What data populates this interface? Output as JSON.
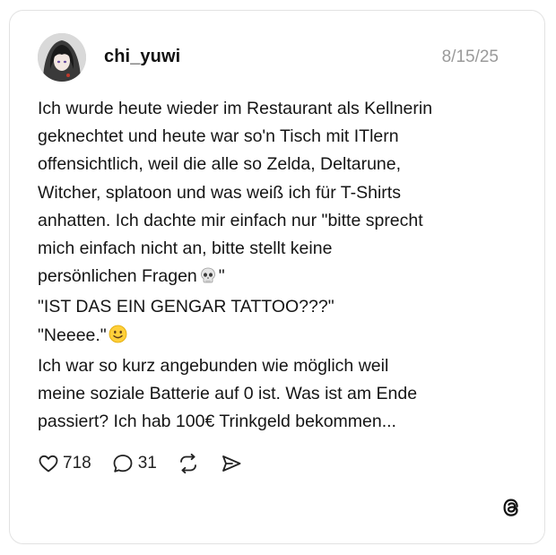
{
  "post": {
    "username": "chi_yuwi",
    "date": "8/15/25",
    "body_lines": [
      {
        "text": "Ich wurde heute wieder im Restaurant als Kellnerin"
      },
      {
        "text": "geknechtet und heute war so'n Tisch mit ITlern"
      },
      {
        "text": "offensichtlich, weil die alle so Zelda, Deltarune,"
      },
      {
        "text": "Witcher,  splatoon und was weiß ich für T-Shirts"
      },
      {
        "text": "anhatten. Ich dachte mir einfach nur \"bitte sprecht"
      },
      {
        "text": "mich einfach nicht an, bitte stellt keine"
      },
      {
        "text": "persönlichen Fragen",
        "emoji": "skull-emoji",
        "after": "\""
      },
      {
        "text": "\"IST DAS EIN GENGAR TATTOO???\""
      },
      {
        "text": "\"Neeee.\"",
        "emoji": "slightly-smiling-face-emoji",
        "after": ""
      },
      {
        "text": "Ich war so kurz angebunden wie möglich weil"
      },
      {
        "text": "meine soziale Batterie auf 0 ist. Was ist am Ende"
      },
      {
        "text": "passiert? Ich hab 100€ Trinkgeld bekommen..."
      }
    ]
  },
  "actions": {
    "likes": "718",
    "replies": "31",
    "icons": [
      "heart-icon",
      "reply-icon",
      "repost-icon",
      "share-icon"
    ]
  },
  "brand": {
    "logo": "threads-logo-icon"
  },
  "colors": {
    "text": "#151515",
    "muted": "#9a9a9a",
    "border": "#e2e2e2",
    "background": "#ffffff"
  }
}
